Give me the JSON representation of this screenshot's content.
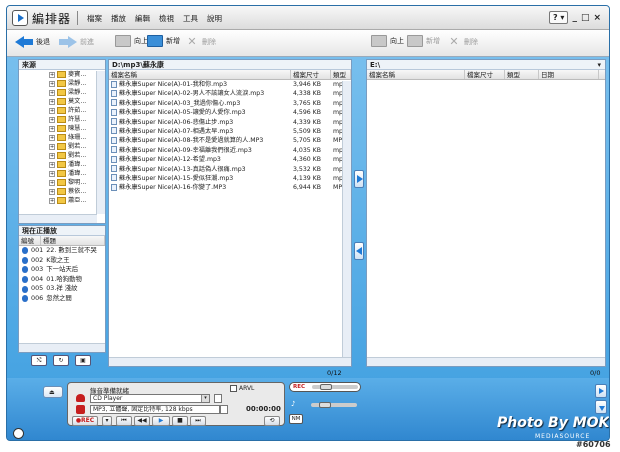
{
  "app": {
    "title": "編排器"
  },
  "menu": [
    "檔案",
    "播放",
    "編輯",
    "檢視",
    "工具",
    "說明"
  ],
  "window_controls": {
    "help": "?",
    "minimize": "_",
    "maximize": "□",
    "close": "×"
  },
  "toolbar": {
    "back": "後退",
    "forward": "前進",
    "left_up": "向上",
    "left_new": "新增",
    "left_delete": "刪除",
    "right_up": "向上",
    "right_new": "新增",
    "right_delete": "刪除"
  },
  "source": {
    "title": "來源",
    "tree": [
      "麥寶...",
      "梁靜...",
      "梁靜...",
      "莫文...",
      "許茹...",
      "許慧...",
      "陳慧...",
      "綠珊...",
      "劉若...",
      "劉若...",
      "潘瑋...",
      "潘瑋...",
      "黎明...",
      "蔡依...",
      "蕭亞..."
    ]
  },
  "now_playing": {
    "title": "現在正播放",
    "columns": [
      "編號",
      "標題"
    ],
    "items": [
      {
        "num": "001",
        "title": "22. 數到三就不哭"
      },
      {
        "num": "002",
        "title": "K歌之王"
      },
      {
        "num": "003",
        "title": "下一站天后"
      },
      {
        "num": "004",
        "title": "01.哈狗動物"
      },
      {
        "num": "005",
        "title": "03.祥  淺紋"
      },
      {
        "num": "006",
        "title": "忽然之間"
      }
    ]
  },
  "left_list": {
    "path": "D:\\mp3\\蘇永康",
    "columns": [
      "檔案名稱",
      "檔案尺寸",
      "類型"
    ],
    "rows": [
      {
        "name": "蘇永康Super Nice(A)-01-我和你.mp3",
        "size": "3,946 KB",
        "type": "mp3"
      },
      {
        "name": "蘇永康Super Nice(A)-02-男人不該讓女人流淚.mp3",
        "size": "4,338 KB",
        "type": "mp3"
      },
      {
        "name": "蘇永康Super Nice(A)-03_我過你傷心.mp3",
        "size": "3,765 KB",
        "type": "mp3"
      },
      {
        "name": "蘇永康Super Nice(A)-05-讓愛的人愛你.mp3",
        "size": "4,596 KB",
        "type": "mp3"
      },
      {
        "name": "蘇永康Super Nice(A)-06-悲傷止步.mp3",
        "size": "4,339 KB",
        "type": "mp3"
      },
      {
        "name": "蘇永康Super Nice(A)-07-相遇太早.mp3",
        "size": "5,509 KB",
        "type": "mp3"
      },
      {
        "name": "蘇永康Super Nice(A)-08-我不是愛過就算的人.MP3",
        "size": "5,705 KB",
        "type": "MP3"
      },
      {
        "name": "蘇永康Super Nice(A)-09-幸福離我們很近.mp3",
        "size": "4,035 KB",
        "type": "mp3"
      },
      {
        "name": "蘇永康Super Nice(A)-12-希望.mp3",
        "size": "4,360 KB",
        "type": "mp3"
      },
      {
        "name": "蘇永康Super Nice(A)-13-真話偽人很痛.mp3",
        "size": "3,532 KB",
        "type": "mp3"
      },
      {
        "name": "蘇永康Super Nice(A)-15-愛似狂潮.mp3",
        "size": "4,139 KB",
        "type": "mp3"
      },
      {
        "name": "蘇永康Super Nice(A)-16-你變了.MP3",
        "size": "6,944 KB",
        "type": "MP3"
      }
    ],
    "count": "0/12"
  },
  "right_list": {
    "path": "E:\\",
    "columns": [
      "檔案名稱",
      "檔案尺寸",
      "類型",
      "日期"
    ],
    "count": "0/0"
  },
  "player": {
    "source_label": "錄音準備就緒",
    "arvl": "ARVL",
    "source_select": "CD Player",
    "format_select": "MP3, 立體聲, 固定比特率, 128 kbps",
    "time": "00:00:00",
    "rec": "REC",
    "rec2": "●REC",
    "nm": "NM"
  },
  "watermark": {
    "text": "Photo By MOK",
    "brand": "MEDIASOURCE",
    "id": "#60706"
  },
  "colors": {
    "frame": "#3d9ee0",
    "rec": "#d01818",
    "accent": "#1f7ad6"
  }
}
